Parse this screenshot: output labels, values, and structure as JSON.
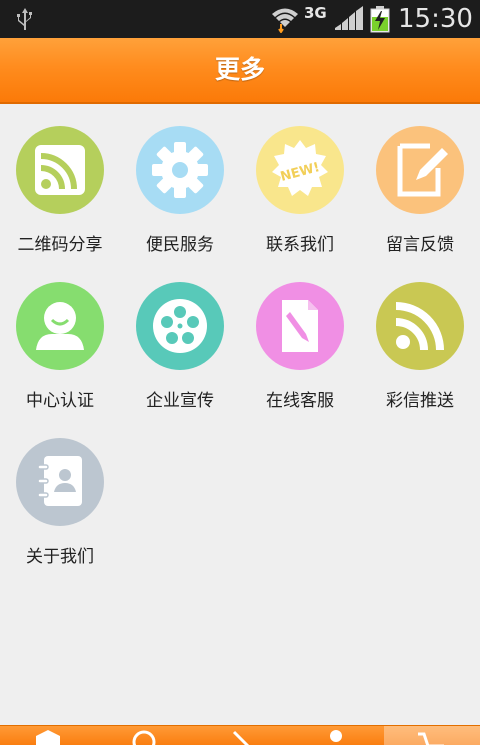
{
  "status_bar": {
    "network": "3G",
    "time": "15:30",
    "icons": [
      "usb-icon",
      "wifi-icon",
      "signal-icon",
      "battery-charging-icon"
    ]
  },
  "header": {
    "title": "更多"
  },
  "grid": {
    "items": [
      {
        "label": "二维码分享",
        "icon": "rss-icon",
        "color": "#b5cf5c"
      },
      {
        "label": "便民服务",
        "icon": "gear-icon",
        "color": "#9fd8f2"
      },
      {
        "label": "联系我们",
        "icon": "new-badge-icon",
        "color": "#f8e68a"
      },
      {
        "label": "留言反馈",
        "icon": "edit-note-icon",
        "color": "#fbc07a"
      },
      {
        "label": "中心认证",
        "icon": "user-icon",
        "color": "#86dd6f"
      },
      {
        "label": "企业宣传",
        "icon": "film-reel-icon",
        "color": "#58c9b9"
      },
      {
        "label": "在线客服",
        "icon": "document-edit-icon",
        "color": "#f08fe4"
      },
      {
        "label": "彩信推送",
        "icon": "rss-icon",
        "color": "#c9c853"
      },
      {
        "label": "关于我们",
        "icon": "contact-book-icon",
        "color": "#bcc6d0"
      }
    ]
  },
  "tabbar": {
    "tabs": [
      {
        "icon": "home-icon"
      },
      {
        "icon": "globe-icon"
      },
      {
        "icon": "search-icon"
      },
      {
        "icon": "user-icon"
      },
      {
        "icon": "cart-icon",
        "active": true
      }
    ]
  }
}
